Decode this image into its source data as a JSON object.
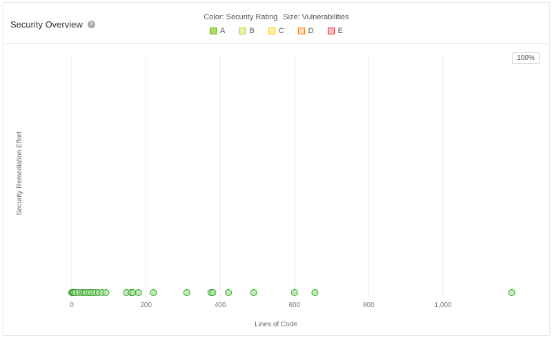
{
  "header": {
    "title": "Security Overview",
    "help_icon": "?",
    "color_label": "Color: Security Rating",
    "size_label": "Size: Vulnerabilities"
  },
  "legend": [
    {
      "label": "A",
      "fill": "#b0d86c",
      "border": "#57b300"
    },
    {
      "label": "B",
      "fill": "#e8f59b",
      "border": "#b0d513"
    },
    {
      "label": "C",
      "fill": "#fff2a6",
      "border": "#eabe06"
    },
    {
      "label": "D",
      "fill": "#ffd9c2",
      "border": "#ed7d20"
    },
    {
      "label": "E",
      "fill": "#ffb9bc",
      "border": "#d02f3a"
    }
  ],
  "zoom": "100%",
  "chart_data": {
    "type": "scatter",
    "xlabel": "Lines of Code",
    "ylabel": "Security Remediation Effort",
    "xlim": [
      0,
      1200
    ],
    "ticks": [
      {
        "value": 0,
        "label": "0"
      },
      {
        "value": 200,
        "label": "200"
      },
      {
        "value": 400,
        "label": "400"
      },
      {
        "value": 600,
        "label": "600"
      },
      {
        "value": 800,
        "label": "800"
      },
      {
        "value": 1000,
        "label": "1,000"
      }
    ],
    "point_color": {
      "fill": "#b4e6a1",
      "stroke": "#2ca02c"
    },
    "x": [
      0,
      2,
      3,
      6,
      10,
      18,
      27,
      32,
      37,
      44,
      50,
      57,
      64,
      72,
      82,
      92,
      147,
      160,
      165,
      180,
      220,
      310,
      375,
      380,
      422,
      490,
      600,
      655,
      1185
    ],
    "y": [
      0,
      0,
      0,
      0,
      0,
      0,
      0,
      0,
      0,
      0,
      0,
      0,
      0,
      0,
      0,
      0,
      0,
      0,
      0,
      0,
      0,
      0,
      0,
      0,
      0,
      0,
      0,
      0,
      0
    ]
  }
}
